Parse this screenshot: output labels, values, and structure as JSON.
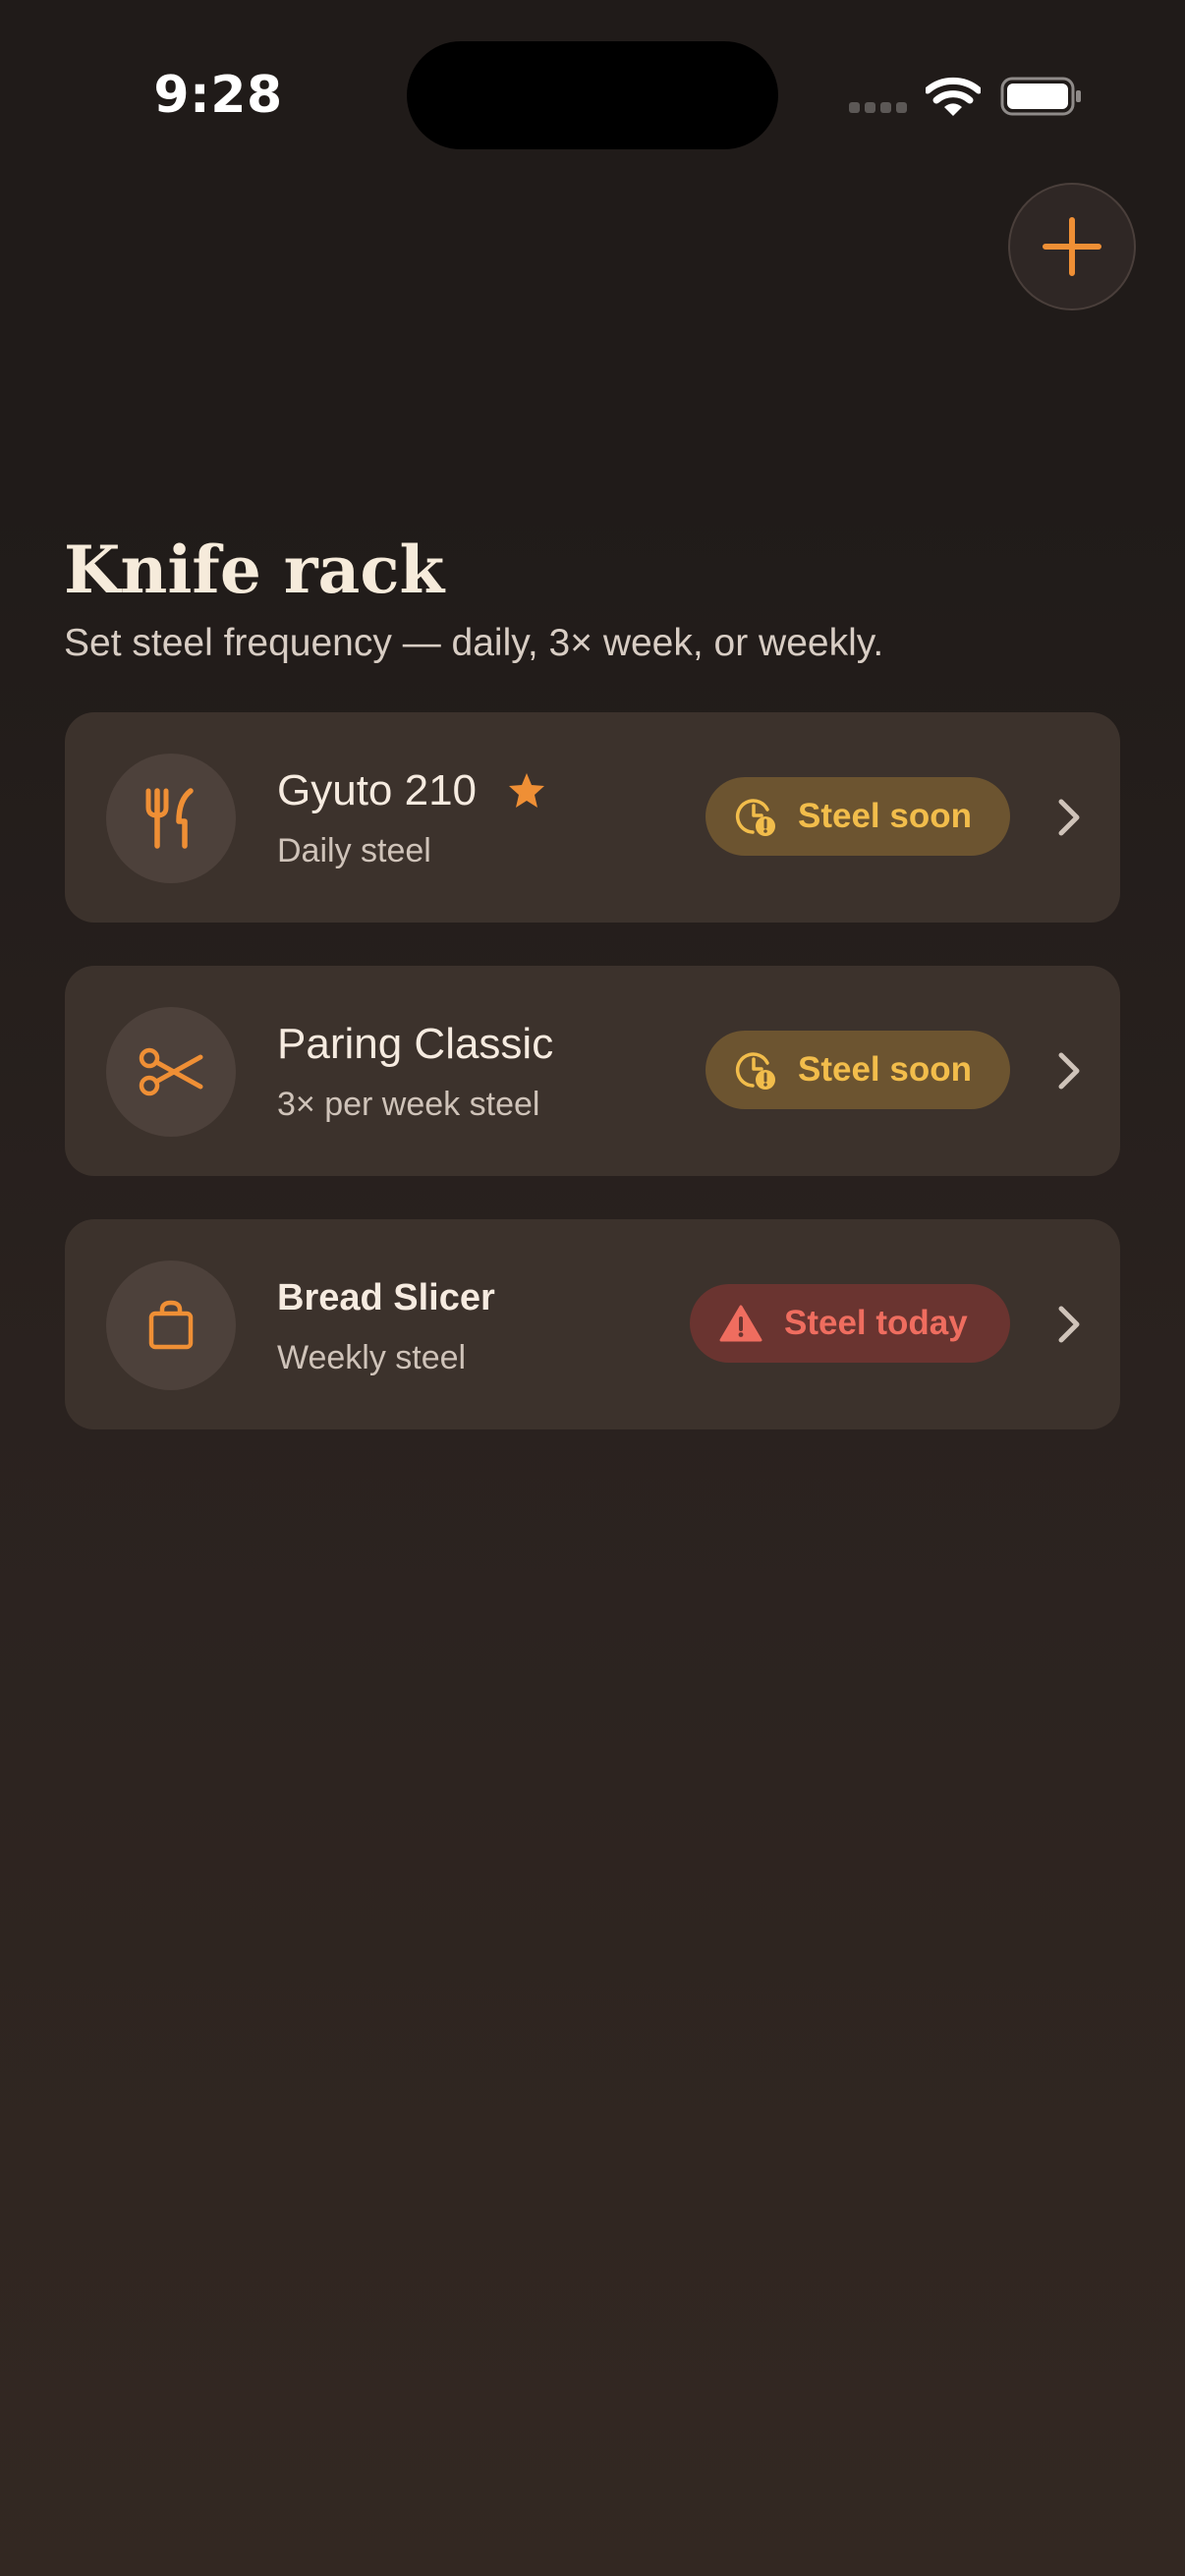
{
  "status_bar": {
    "time": "9:28"
  },
  "header": {
    "title": "Knife rack",
    "subtitle": "Set steel frequency — daily, 3× week, or weekly."
  },
  "colors": {
    "accent": "#ef8f35",
    "soon_badge_bg": "#6c5430",
    "soon_badge_text": "#f2bd4b",
    "today_badge_bg": "#6a3430",
    "today_badge_text": "#ef6d5f",
    "card_bg": "#3c322c"
  },
  "knives": [
    {
      "name": "Gyuto 210",
      "frequency": "Daily steel",
      "icon": "fork-knife-icon",
      "favorite": true,
      "status": "Steel soon",
      "status_icon": "clock-alert-icon"
    },
    {
      "name": "Paring Classic",
      "frequency": "3× per week steel",
      "icon": "scissors-icon",
      "favorite": false,
      "status": "Steel soon",
      "status_icon": "clock-alert-icon"
    },
    {
      "name": "Bread Slicer",
      "frequency": "Weekly steel",
      "icon": "bag-icon",
      "favorite": false,
      "status": "Steel today",
      "status_icon": "warning-triangle-icon"
    }
  ]
}
